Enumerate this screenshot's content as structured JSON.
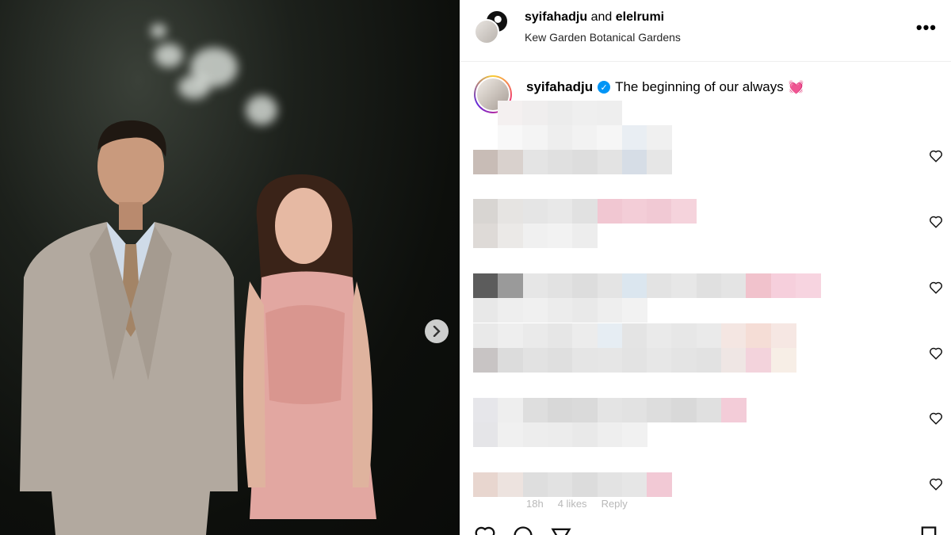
{
  "post": {
    "header": {
      "user1": "syifahadju",
      "conjunction": "and",
      "user2": "elelrumi",
      "location": "Kew Garden Botanical Gardens",
      "more": "•••"
    },
    "caption": {
      "username": "syifahadju",
      "verified": true,
      "text": "The beginning of our always",
      "emoji": "💓"
    },
    "last_comment_meta": {
      "time": "18h",
      "likes": "4 likes",
      "reply": "Reply"
    }
  },
  "icons": {
    "next": "chevron-right-icon",
    "more": "more-icon",
    "like": "heart-outline-icon",
    "verified": "verified-badge-icon"
  },
  "colors": {
    "verified": "#0095f6",
    "accent_pink": "#f2c4d2"
  }
}
